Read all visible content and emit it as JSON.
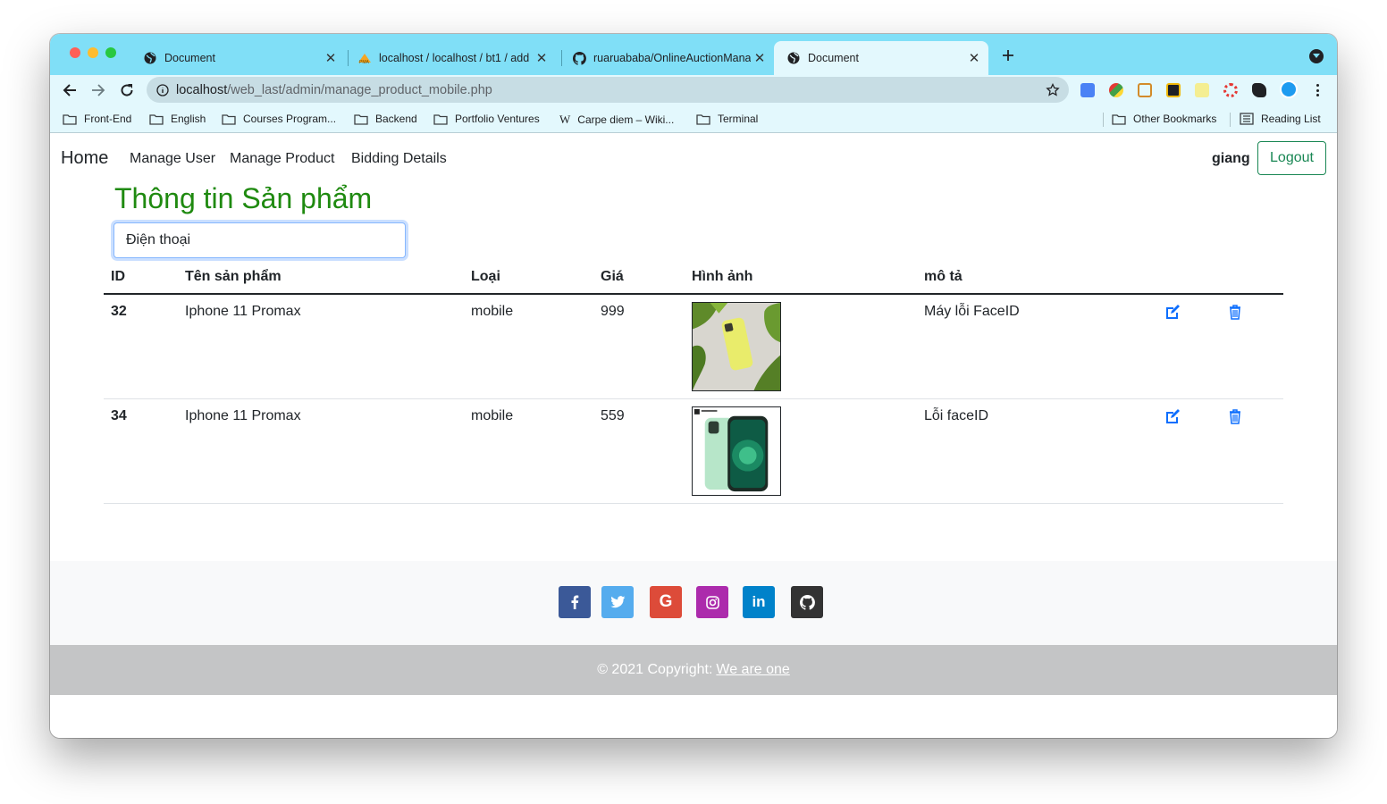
{
  "browser": {
    "tabs": [
      {
        "title": "Document",
        "favicon": "globe-icon",
        "active": false
      },
      {
        "title": "localhost / localhost / bt1 / add",
        "favicon": "phpmyadmin-icon",
        "active": false
      },
      {
        "title": "ruaruababa/OnlineAuctionMana",
        "favicon": "github-icon",
        "active": false
      },
      {
        "title": "Document",
        "favicon": "globe-icon",
        "active": true
      }
    ],
    "url_host": "localhost",
    "url_path": "/web_last/admin/manage_product_mobile.php",
    "bookmarks": [
      "Front-End",
      "English",
      "Courses Program...",
      "Backend",
      "Portfolio Ventures",
      "Carpe diem – Wiki...",
      "Terminal"
    ],
    "other_bookmarks": "Other Bookmarks",
    "reading_list": "Reading List"
  },
  "navbar": {
    "brand": "Home",
    "links": [
      "Manage User",
      "Manage Product",
      "Bidding Details"
    ],
    "username": "giang",
    "logout": "Logout"
  },
  "main": {
    "title": "Thông tin Sản phẩm",
    "search_value": "Điện thoại",
    "columns": [
      "ID",
      "Tên sản phẩm",
      "Loại",
      "Giá",
      "Hình ảnh",
      "mô tả"
    ],
    "rows": [
      {
        "id": "32",
        "name": "Iphone 11 Promax",
        "type": "mobile",
        "price": "999",
        "description": "Máy lỗi FaceID",
        "image": "yellow-iphone-photo"
      },
      {
        "id": "34",
        "name": "Iphone 11 Promax",
        "type": "mobile",
        "price": "559",
        "description": "Lỗi faceID",
        "image": "green-iphone-photo"
      }
    ]
  },
  "footer": {
    "social": [
      "facebook",
      "twitter",
      "google",
      "instagram",
      "linkedin",
      "github"
    ],
    "copyright_prefix": "© 2021 Copyright:",
    "copyright_link": "We are one"
  },
  "colors": {
    "tabstrip": "#80dff7",
    "heading": "#1f8a10",
    "logout": "#198754",
    "action_icons": "#0d6efd",
    "footer_bar": "#c4c5c6"
  }
}
